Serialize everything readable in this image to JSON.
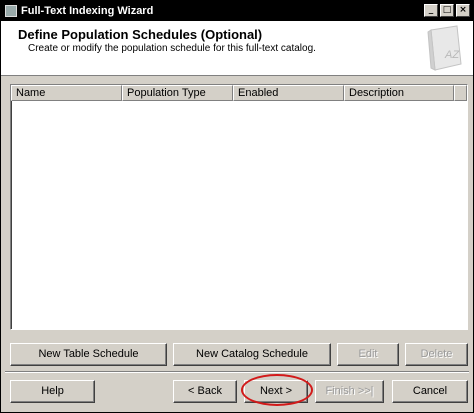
{
  "window": {
    "title": "Full-Text Indexing Wizard",
    "controls": {
      "minimize": "_",
      "maximize": "□",
      "close": "×"
    }
  },
  "header": {
    "title": "Define Population Schedules (Optional)",
    "subtitle": "Create or modify the population schedule for this full-text catalog.",
    "graphic_text": "AZ"
  },
  "listview": {
    "columns": [
      "Name",
      "Population Type",
      "Enabled",
      "Description"
    ],
    "rows": []
  },
  "actions": {
    "new_table_schedule": "New Table Schedule",
    "new_catalog_schedule": "New Catalog Schedule",
    "edit": "Edit",
    "delete": "Delete"
  },
  "nav": {
    "help": "Help",
    "back": "< Back",
    "next": "Next >",
    "finish": "Finish >>|",
    "cancel": "Cancel"
  },
  "colors": {
    "titlebar": "#000000",
    "face": "#d4d0c8",
    "highlight_ring": "#d21a1a"
  }
}
